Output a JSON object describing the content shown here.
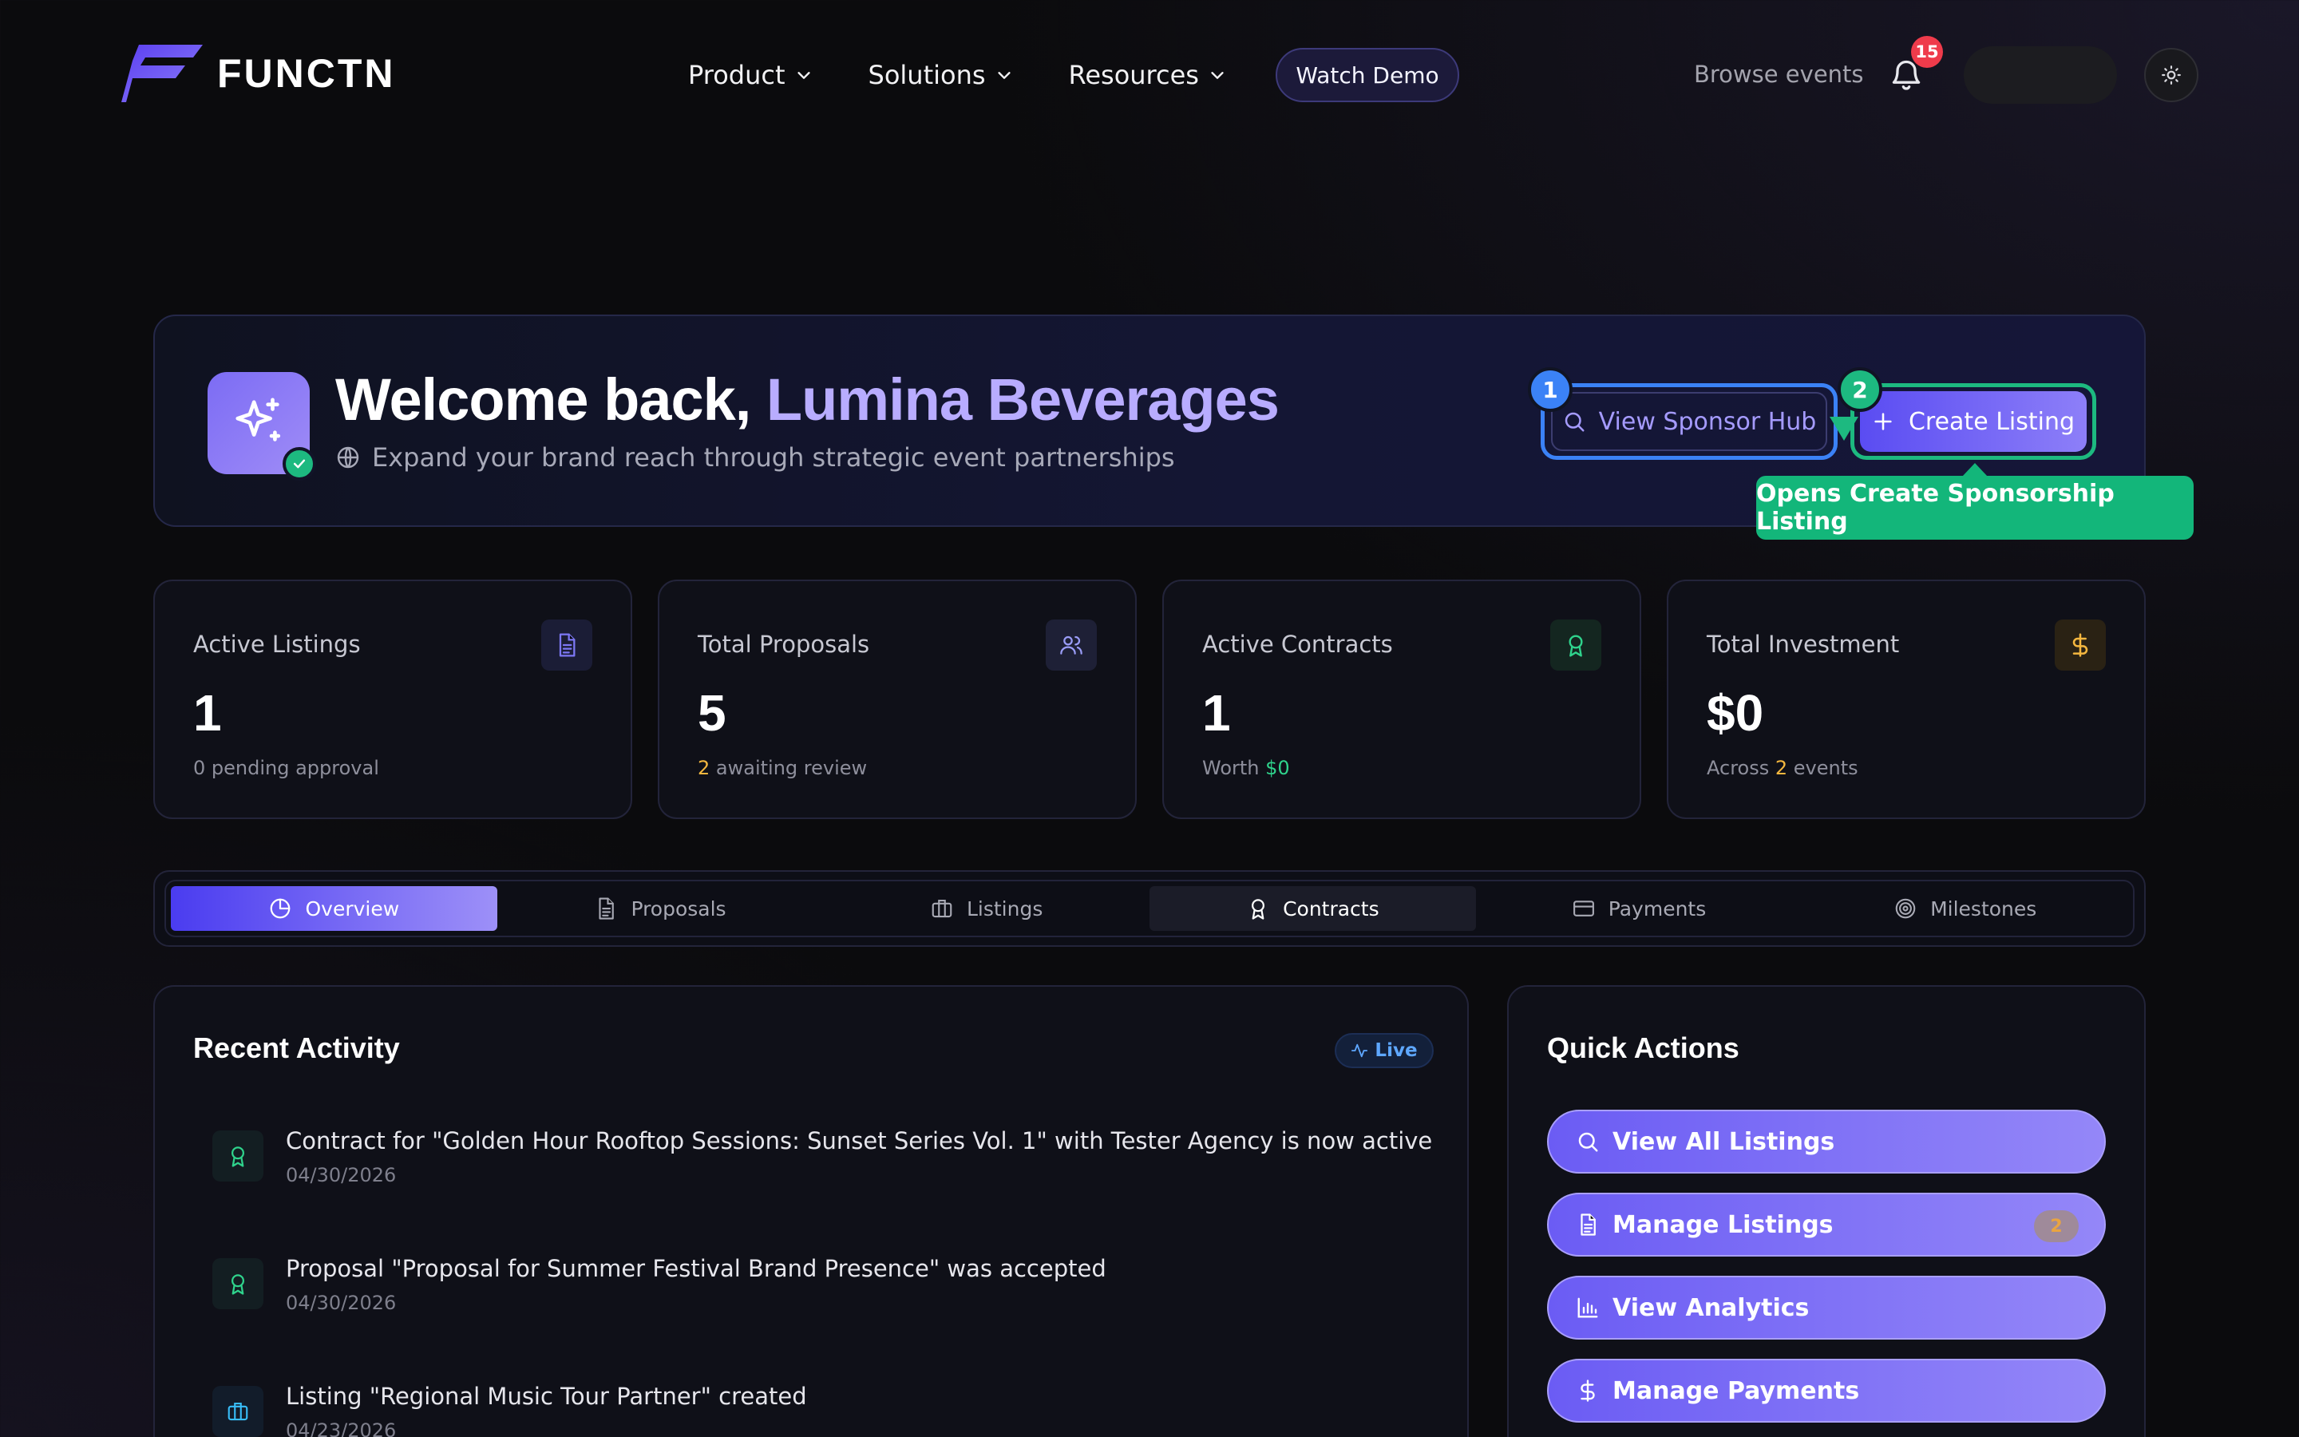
{
  "brand": {
    "name": "FUNCTN"
  },
  "nav": {
    "menu": [
      {
        "label": "Product"
      },
      {
        "label": "Solutions"
      },
      {
        "label": "Resources"
      }
    ],
    "watch_demo": "Watch Demo",
    "browse_events": "Browse events",
    "notification_count": "15"
  },
  "welcome": {
    "greeting": "Welcome back, ",
    "company": "Lumina Beverages",
    "subtitle": "Expand your brand reach through strategic event partnerships",
    "view_hub": "View Sponsor Hub",
    "create_listing": "Create Listing",
    "step_1": "1",
    "step_2": "2",
    "tooltip": "Opens Create Sponsorship Listing"
  },
  "stats": [
    {
      "label": "Active Listings",
      "value": "1",
      "foot_num": "",
      "foot": "0 pending approval",
      "icon": "document-icon"
    },
    {
      "label": "Total Proposals",
      "value": "5",
      "foot_num": "2",
      "foot": " awaiting review",
      "icon": "users-icon"
    },
    {
      "label": "Active Contracts",
      "value": "1",
      "foot_pre": "Worth ",
      "foot_num": "$0",
      "icon": "award-icon"
    },
    {
      "label": "Total Investment",
      "value": "$0",
      "foot_pre": "Across ",
      "foot_num": "2",
      "foot": " events",
      "icon": "dollar-icon"
    }
  ],
  "tabs": [
    {
      "label": "Overview",
      "state": "active"
    },
    {
      "label": "Proposals"
    },
    {
      "label": "Listings"
    },
    {
      "label": "Contracts",
      "state": "hover"
    },
    {
      "label": "Payments"
    },
    {
      "label": "Milestones"
    }
  ],
  "activity": {
    "title": "Recent Activity",
    "live": "Live",
    "items": [
      {
        "text": "Contract for \"Golden Hour Rooftop Sessions: Sunset Series Vol. 1\" with Tester Agency is now active",
        "date": "04/30/2026",
        "icon": "award-icon"
      },
      {
        "text": "Proposal \"Proposal for Summer Festival Brand Presence\" was accepted",
        "date": "04/30/2026",
        "icon": "award-icon"
      },
      {
        "text": "Listing \"Regional Music Tour Partner\" created",
        "date": "04/23/2026",
        "icon": "briefcase-icon"
      }
    ]
  },
  "quick_actions": {
    "title": "Quick Actions",
    "items": [
      {
        "label": "View All Listings",
        "icon": "search-icon"
      },
      {
        "label": "Manage Listings",
        "icon": "document-icon",
        "badge": "2"
      },
      {
        "label": "View Analytics",
        "icon": "bar-chart-icon"
      },
      {
        "label": "Manage Payments",
        "icon": "dollar-icon"
      }
    ]
  },
  "colors": {
    "accent": "#6b5cf4",
    "step_blue": "#3b82f6",
    "step_green": "#1db980",
    "alert_red": "#ef3b4b",
    "amber": "#f4b73f"
  }
}
